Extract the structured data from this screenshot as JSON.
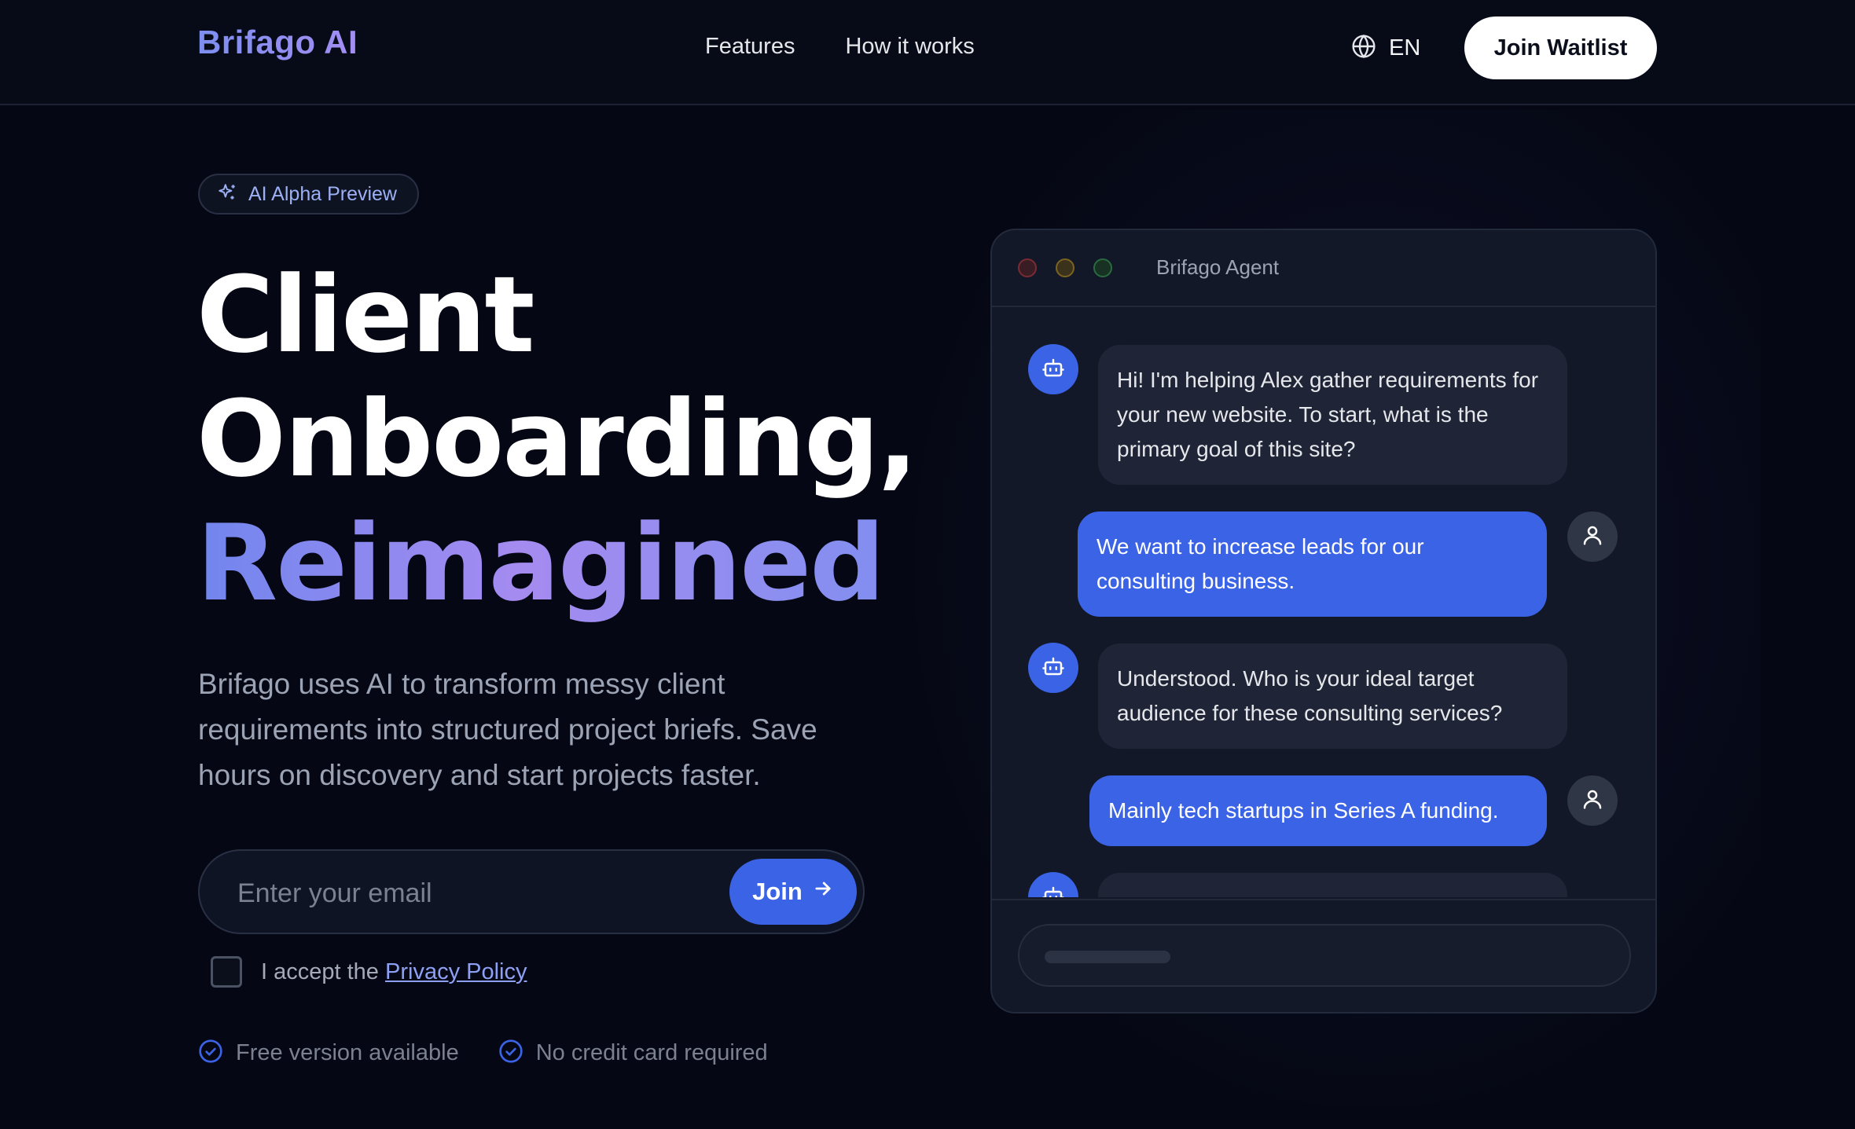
{
  "brand": {
    "name": "Brifago AI"
  },
  "nav": {
    "links": [
      {
        "label": "Features"
      },
      {
        "label": "How it works"
      }
    ],
    "language": {
      "label": "EN",
      "icon": "globe-icon"
    },
    "cta_label": "Join Waitlist"
  },
  "hero": {
    "badge": {
      "label": "AI Alpha Preview",
      "icon": "sparkles-icon"
    },
    "title": {
      "line1": "Client",
      "line2": "Onboarding,",
      "line3": "Reimagined"
    },
    "subtitle": "Brifago uses AI to transform messy client requirements into structured project briefs. Save hours on discovery and start projects faster.",
    "form": {
      "email_placeholder": "Enter your email",
      "email_value": "",
      "join_label": "Join",
      "join_icon": "arrow-right-icon",
      "consent_prefix": "I accept the",
      "consent_link": "Privacy Policy",
      "consent_checked": false
    },
    "perks": [
      {
        "label": "Free version available",
        "icon": "check-circle-icon"
      },
      {
        "label": "No credit card required",
        "icon": "check-circle-icon"
      }
    ]
  },
  "chat": {
    "title": "Brifago Agent",
    "messages": [
      {
        "role": "bot",
        "text": "Hi! I'm helping Alex gather requirements for your new website. To start, what is the primary goal of this site?"
      },
      {
        "role": "user",
        "text": "We want to increase leads for our consulting business."
      },
      {
        "role": "bot",
        "text": "Understood. Who is your ideal target audience for these consulting services?"
      },
      {
        "role": "user",
        "text": "Mainly tech startups in Series A funding."
      },
      {
        "role": "bot",
        "text": ""
      }
    ]
  },
  "colors": {
    "background": "#050814",
    "accent": "#3b63e6",
    "gradient_start": "#7186ee",
    "gradient_end": "#a58bf0",
    "panel": "#121827"
  }
}
